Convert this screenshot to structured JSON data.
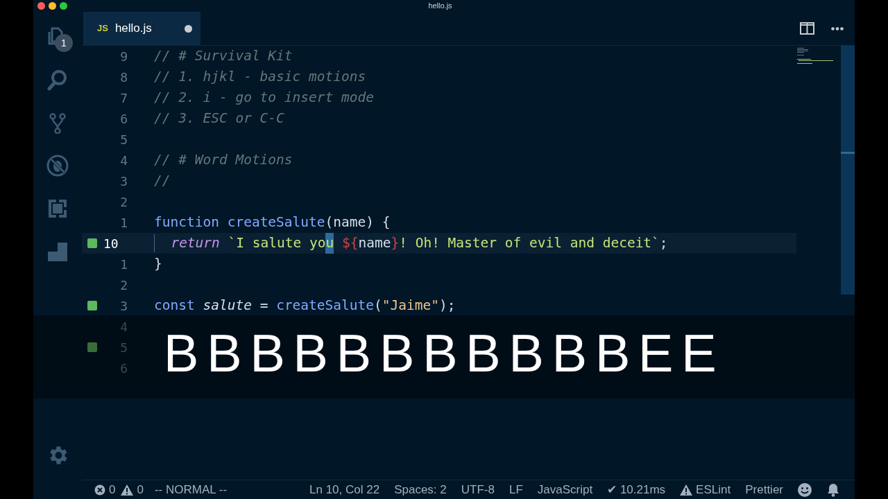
{
  "window": {
    "title": "hello.js"
  },
  "activity_bar": {
    "items": [
      {
        "kind": "files",
        "badge": "1"
      },
      {
        "kind": "search"
      },
      {
        "kind": "git"
      },
      {
        "kind": "debug"
      },
      {
        "kind": "extensions"
      },
      {
        "kind": "blocks"
      }
    ]
  },
  "tabs": [
    {
      "icon": "JS",
      "label": "hello.js",
      "dirty": true,
      "selected": true
    }
  ],
  "editor": {
    "lines": [
      {
        "number": "9",
        "tokens": [
          {
            "kind": "comment",
            "text": "// # Survival Kit"
          }
        ]
      },
      {
        "number": "8",
        "tokens": [
          {
            "kind": "comment",
            "text": "// 1. hjkl - basic motions"
          }
        ]
      },
      {
        "number": "7",
        "tokens": [
          {
            "kind": "comment",
            "text": "// 2. i - go to insert mode"
          }
        ]
      },
      {
        "number": "6",
        "tokens": [
          {
            "kind": "comment",
            "text": "// 3. ESC or C-C"
          }
        ]
      },
      {
        "number": "5"
      },
      {
        "number": "4",
        "tokens": [
          {
            "kind": "comment",
            "text": "// # Word Motions"
          }
        ]
      },
      {
        "number": "3",
        "tokens": [
          {
            "kind": "comment",
            "text": "//"
          }
        ]
      },
      {
        "number": "2"
      },
      {
        "number": "1",
        "tokens": [
          {
            "kind": "keyword",
            "text": "function "
          },
          {
            "kind": "function",
            "text": "createSalute"
          },
          {
            "kind": "plain",
            "text": "(name) {"
          }
        ]
      },
      {
        "number": "10",
        "current": true,
        "added": true,
        "indent": true,
        "tokens": [
          {
            "kind": "control",
            "text": "return"
          },
          {
            "kind": "string",
            "text": " `I salute yo"
          },
          {
            "kind": "cursor",
            "text": "u"
          },
          {
            "kind": "interp",
            "text": " ${"
          },
          {
            "kind": "plain",
            "text": "name"
          },
          {
            "kind": "interp",
            "text": "}"
          },
          {
            "kind": "string",
            "text": "! Oh! Master of evil and deceit`"
          },
          {
            "kind": "plain",
            "text": ";"
          }
        ]
      },
      {
        "number": "1",
        "tokens": [
          {
            "kind": "plain",
            "text": "}"
          }
        ]
      },
      {
        "number": "2"
      },
      {
        "number": "3",
        "added": true,
        "tokens": [
          {
            "kind": "keyword",
            "text": "const "
          },
          {
            "kind": "variable",
            "text": "salute"
          },
          {
            "kind": "plain",
            "text": " = "
          },
          {
            "kind": "function",
            "text": "createSalute"
          },
          {
            "kind": "plain",
            "text": "("
          },
          {
            "kind": "string2",
            "text": "\"Jaime\""
          },
          {
            "kind": "plain",
            "text": ");"
          }
        ]
      },
      {
        "number": "4"
      },
      {
        "number": "5",
        "added": true
      },
      {
        "number": "6"
      }
    ]
  },
  "caption": "BBBBBBBBBBBEE",
  "status_bar": {
    "errors": "0",
    "warnings": "0",
    "mode": "-- NORMAL --",
    "items": [
      {
        "kind": "text",
        "text": "Ln 10, Col 22"
      },
      {
        "kind": "text",
        "text": "Spaces: 2"
      },
      {
        "kind": "text",
        "text": "UTF-8"
      },
      {
        "kind": "text",
        "text": "LF"
      },
      {
        "kind": "text",
        "text": "JavaScript"
      },
      {
        "kind": "text",
        "text": "✔ 10.21ms"
      },
      {
        "kind": "warning",
        "text": "ESLint"
      },
      {
        "kind": "text",
        "text": "Prettier"
      },
      {
        "kind": "smiley"
      },
      {
        "kind": "bell"
      }
    ]
  }
}
